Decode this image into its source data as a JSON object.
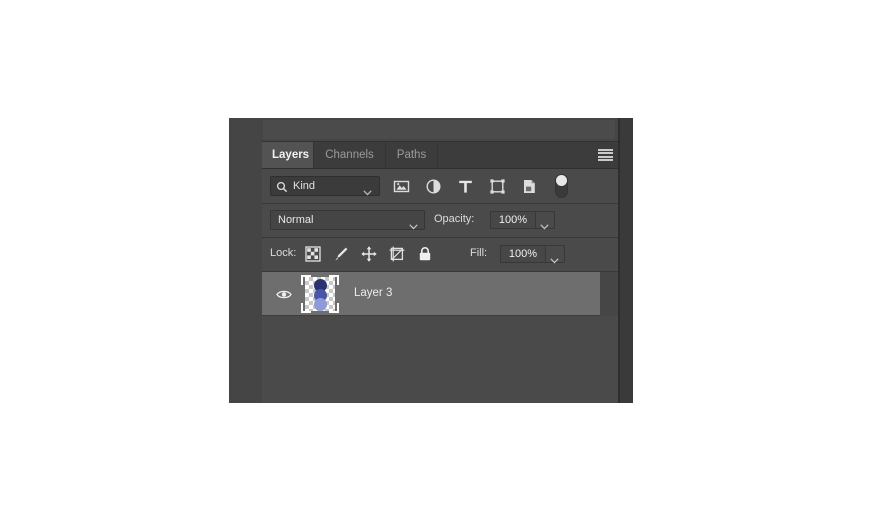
{
  "panel": {
    "title": "Layers",
    "menu_icon": "hamburger-menu-icon",
    "tabs": [
      {
        "label": "Layers",
        "active": true
      },
      {
        "label": "Channels",
        "active": false
      },
      {
        "label": "Paths",
        "active": false
      }
    ]
  },
  "filter": {
    "search_icon": "magnifier-icon",
    "kind_label": "Kind",
    "kind_chevron": "chevron-down-icon",
    "type_filters": [
      {
        "name": "filter-pixel-layers-icon",
        "title": "Pixel layers"
      },
      {
        "name": "filter-adjustment-layers-icon",
        "title": "Adjustment layers"
      },
      {
        "name": "filter-type-layers-icon",
        "title": "Type layers"
      },
      {
        "name": "filter-shape-layers-icon",
        "title": "Shape layers"
      },
      {
        "name": "filter-smart-object-layers-icon",
        "title": "Smart objects"
      }
    ],
    "toggle_name": "filter-enable-toggle",
    "toggle_on": false
  },
  "blend": {
    "mode": "Normal",
    "mode_chevron": "chevron-down-icon",
    "opacity_label": "Opacity:",
    "opacity_value": "100%",
    "opacity_chevron": "chevron-down-icon"
  },
  "lock": {
    "label": "Lock:",
    "buttons": [
      {
        "name": "lock-transparent-pixels-icon",
        "title": "Lock transparent pixels"
      },
      {
        "name": "lock-image-pixels-icon",
        "title": "Lock image pixels"
      },
      {
        "name": "lock-position-icon",
        "title": "Lock position"
      },
      {
        "name": "lock-artboard-nesting-icon",
        "title": "Prevent auto-nesting"
      },
      {
        "name": "lock-all-icon",
        "title": "Lock all"
      }
    ],
    "fill_label": "Fill:",
    "fill_value": "100%",
    "fill_chevron": "chevron-down-icon"
  },
  "layers": [
    {
      "name": "Layer 3",
      "visible": true,
      "selected": true,
      "visibility_icon": "eye-icon",
      "thumbnail": {
        "type": "transparent-checkerboard",
        "shapes": [
          {
            "shape": "circle",
            "color": "#2a3370"
          },
          {
            "shape": "circle",
            "color": "#4a56a8"
          },
          {
            "shape": "circle",
            "color": "#8f9ad8"
          }
        ]
      }
    }
  ],
  "colors": {
    "panel_bg": "#4a4a4a",
    "row_bg": "#4a4a4a",
    "tabbar_bg": "#3c3c3c",
    "active_tab_bg": "#535353",
    "selected_layer_bg": "#6e6e6e",
    "text": "#e2e2e2",
    "muted_text": "#9b9b9b"
  }
}
